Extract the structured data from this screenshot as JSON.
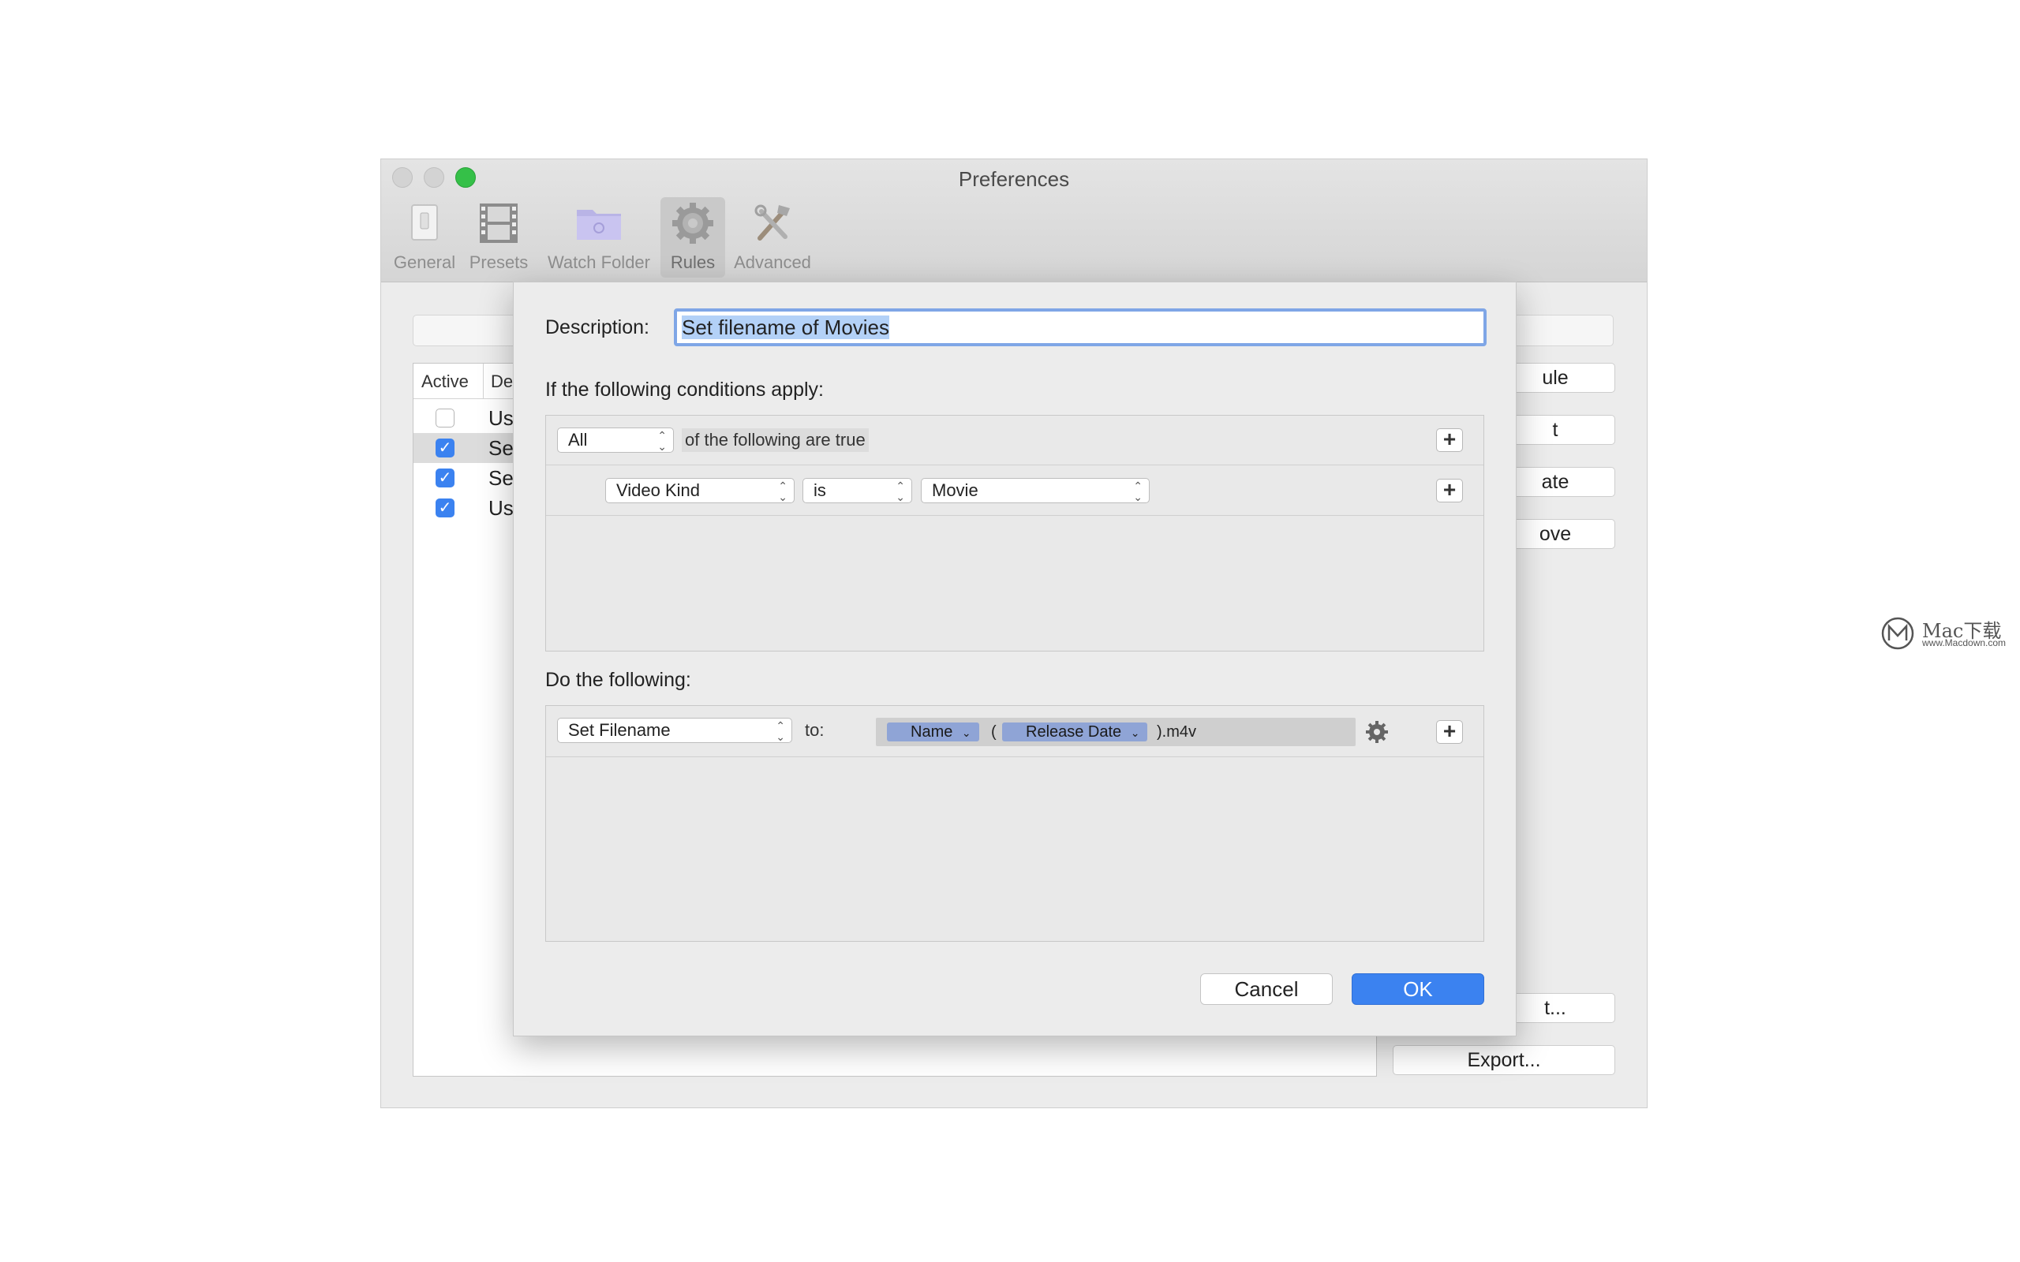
{
  "window": {
    "title": "Preferences",
    "toolbar": [
      {
        "label": "General",
        "icon": "switch-icon"
      },
      {
        "label": "Presets",
        "icon": "film-strip-icon"
      },
      {
        "label": "Watch Folder",
        "icon": "folder-icon"
      },
      {
        "label": "Rules",
        "icon": "gear-icon",
        "selected": true
      },
      {
        "label": "Advanced",
        "icon": "tools-icon"
      }
    ]
  },
  "rules_table": {
    "columns": [
      "Active",
      "De"
    ],
    "rows": [
      {
        "active": false,
        "text": "Us"
      },
      {
        "active": true,
        "text": "Se",
        "selected": true
      },
      {
        "active": true,
        "text": "Se"
      },
      {
        "active": true,
        "text": "Us"
      }
    ]
  },
  "side_buttons": [
    "ule",
    "t",
    "ate",
    "ove",
    "t...",
    "Export..."
  ],
  "sheet": {
    "description_label": "Description:",
    "description_value": "Set filename of Movies",
    "conditions_label": "If the following conditions apply:",
    "match_popup": "All",
    "match_suffix": "of the following are true",
    "condition": {
      "field": "Video Kind",
      "operator": "is",
      "value": "Movie"
    },
    "actions_label": "Do the following:",
    "action": {
      "type": "Set Filename",
      "to_label": "to:",
      "tokens": [
        "Name",
        "Release Date"
      ],
      "paren_open": "(",
      "suffix": ").m4v"
    },
    "cancel_label": "Cancel",
    "ok_label": "OK"
  },
  "watermark": {
    "brand": "Mac下载",
    "url": "www.Macdown.com"
  },
  "colors": {
    "accent": "#3b82f0",
    "token": "#8fa4d6",
    "selection": "#b3d1f7"
  }
}
